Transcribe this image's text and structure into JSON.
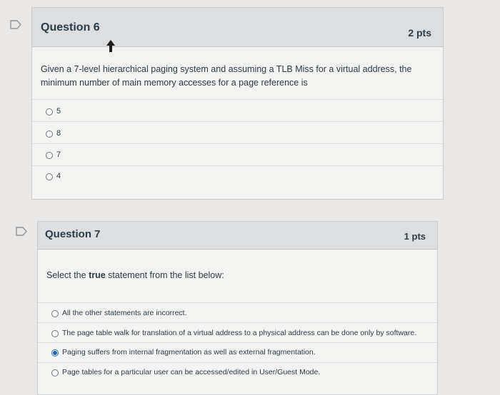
{
  "questions": [
    {
      "title": "Question 6",
      "points": "2 pts",
      "text_line1": "Given a 7-level hierarchical paging system and assuming a TLB Miss for a virtual address,  the",
      "text_line2": "minimum number of main memory accesses for a page reference is",
      "answers": [
        "5",
        "8",
        "7",
        "4"
      ],
      "selected_index": null
    },
    {
      "title": "Question 7",
      "points": "1 pts",
      "text_prefix": "Select the ",
      "text_bold": "true",
      "text_suffix": " statement from the list below:",
      "answers": [
        "All the other statements are incorrect.",
        "The page table walk for translation of a virtual address to a physical address can be done only by software.",
        "Paging suffers from internal fragmentation as well as external fragmentation.",
        "Page tables for a particular user can be accessed/edited in User/Guest Mode."
      ],
      "selected_index": 2
    }
  ],
  "colors": {
    "accent_radio": "#1f62ad",
    "header_bg": "#dcdedf",
    "text": "#2d3b45"
  },
  "icons": [
    "flag-icon",
    "radio-icon",
    "cursor-icon"
  ]
}
